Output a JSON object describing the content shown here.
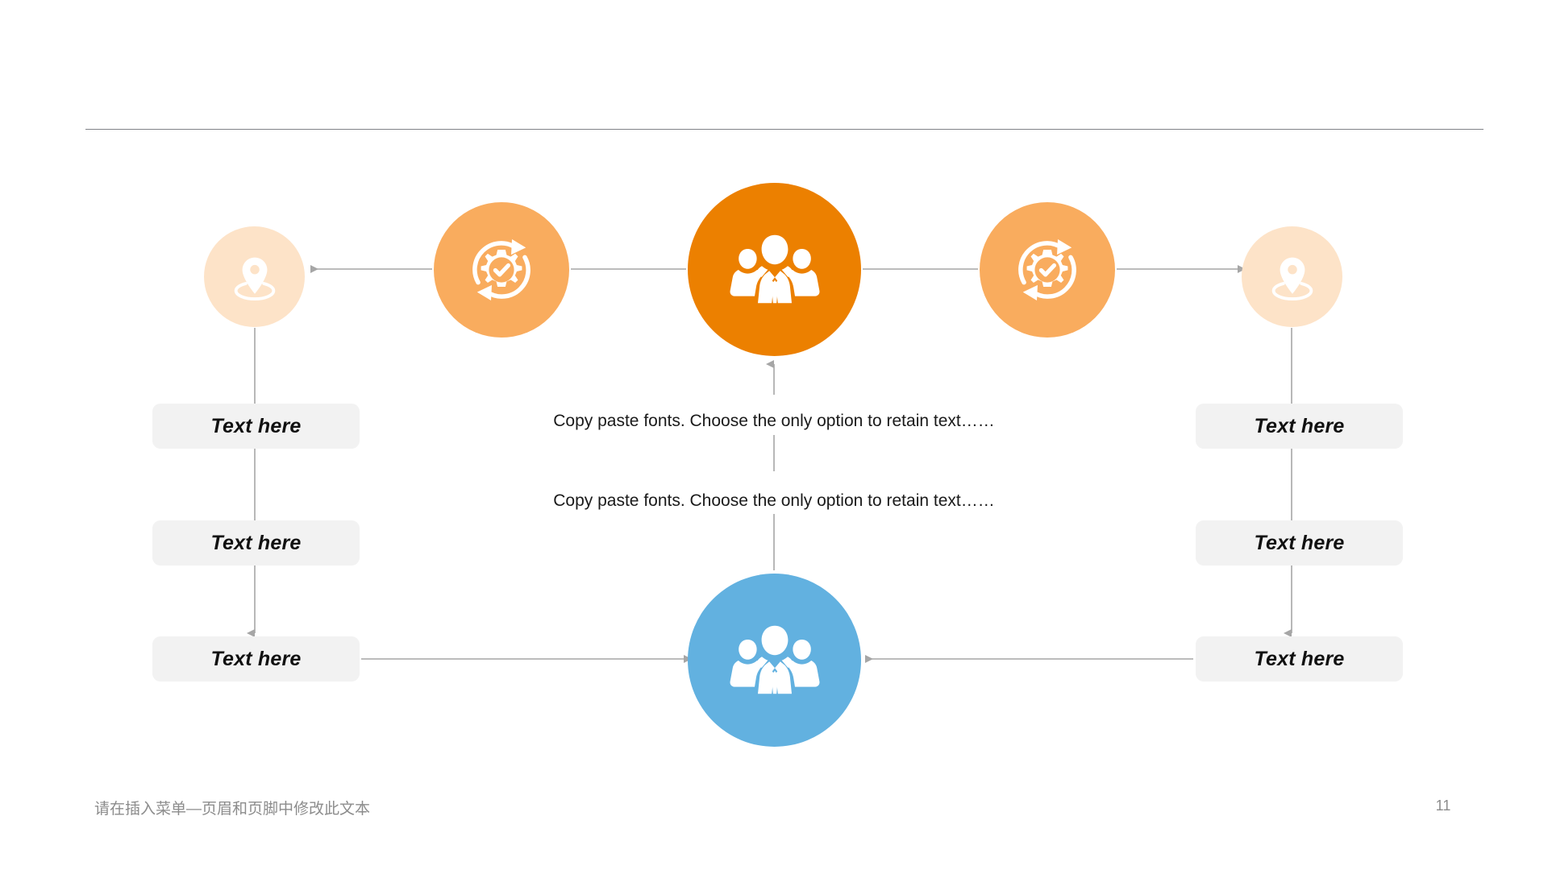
{
  "slide": {
    "page_number": "11",
    "footer_text": "请在插入菜单—页眉和页脚中修改此文本"
  },
  "colors": {
    "accent_orange_dark": "#EC8000",
    "accent_orange_mid": "#F9AC5E",
    "accent_orange_light": "#FDE3C8",
    "accent_blue": "#62B1E0",
    "chip_background": "#F2F2F2",
    "connector_gray": "#A6A6A6",
    "rule_gray": "#808288",
    "footer_gray": "#8C8C8C"
  },
  "nodes": {
    "pin_left": {
      "icon": "map-pin-icon",
      "color": "#FDE3C8"
    },
    "gear_left": {
      "icon": "gear-check-refresh-icon",
      "color": "#F9AC5E"
    },
    "team_top": {
      "icon": "team-people-icon",
      "color": "#EC8000"
    },
    "gear_right": {
      "icon": "gear-check-refresh-icon",
      "color": "#F9AC5E"
    },
    "pin_right": {
      "icon": "map-pin-icon",
      "color": "#FDE3C8"
    },
    "team_bottom": {
      "icon": "team-people-icon",
      "color": "#62B1E0"
    }
  },
  "left_chips": [
    {
      "label": "Text here"
    },
    {
      "label": "Text here"
    },
    {
      "label": "Text here"
    }
  ],
  "right_chips": [
    {
      "label": "Text here"
    },
    {
      "label": "Text here"
    },
    {
      "label": "Text here"
    }
  ],
  "center_lines": [
    {
      "text": "Copy paste fonts. Choose the only option to retain text……"
    },
    {
      "text": "Copy paste fonts. Choose the only option to retain text……"
    }
  ]
}
